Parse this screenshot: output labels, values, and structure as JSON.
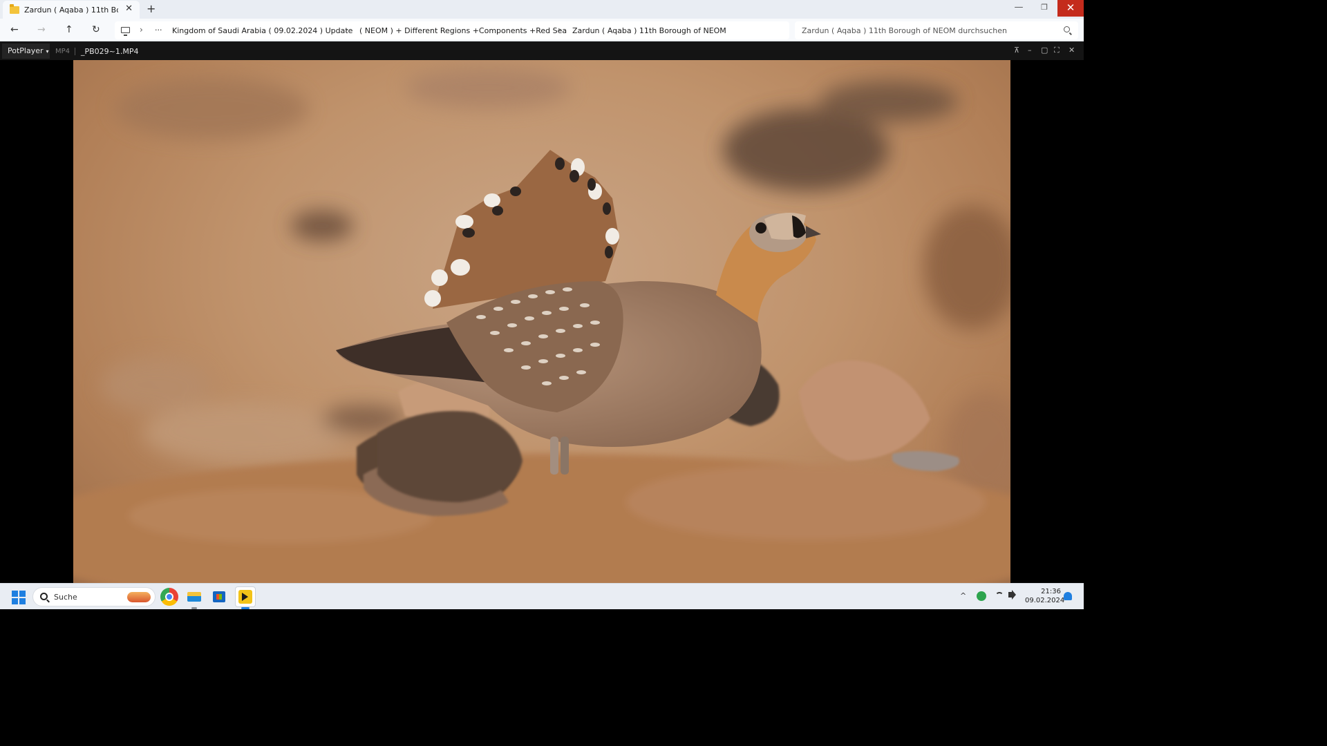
{
  "explorer": {
    "tab_title": "Zardun ( Aqaba )  11th Borough of NEOM",
    "tab_close": "✕",
    "new_tab": "+",
    "window_controls": {
      "minimize": "—",
      "maximize": "❐",
      "close": "✕"
    },
    "nav": {
      "back": "←",
      "forward": "→",
      "up": "↑",
      "refresh": "↻",
      "more": "···",
      "separator": "›"
    },
    "breadcrumbs": [
      "Kingdom of Saudi Arabia ( 09.02.2024 ) Update",
      "( NEOM ) + Different Regions +Components +Red Sea",
      "Zardun ( Aqaba )  11th Borough of NEOM"
    ],
    "search_placeholder": "Zardun ( Aqaba )  11th Borough of NEOM durchsuchen"
  },
  "potplayer": {
    "brand": "PotPlayer",
    "brand_caret": "▾",
    "format": "MP4",
    "filename": "_PB029~1.MP4",
    "controls": {
      "pin": "⊼",
      "minimize": "–",
      "maximize": "▢",
      "fullscreen": "⛶",
      "close": "✕"
    }
  },
  "taskbar": {
    "search_label": "Suche",
    "tray_chevron": "^",
    "time": "21:36",
    "date": "09.02.2024",
    "apps": [
      "chrome-icon",
      "file-explorer-icon",
      "microsoft-store-icon",
      "potplayer-icon"
    ]
  },
  "colors": {
    "close_red": "#c42b1c",
    "accent_blue": "#1f7fe0",
    "folder_yellow": "#f3c33b",
    "player_bar": "#141414"
  }
}
